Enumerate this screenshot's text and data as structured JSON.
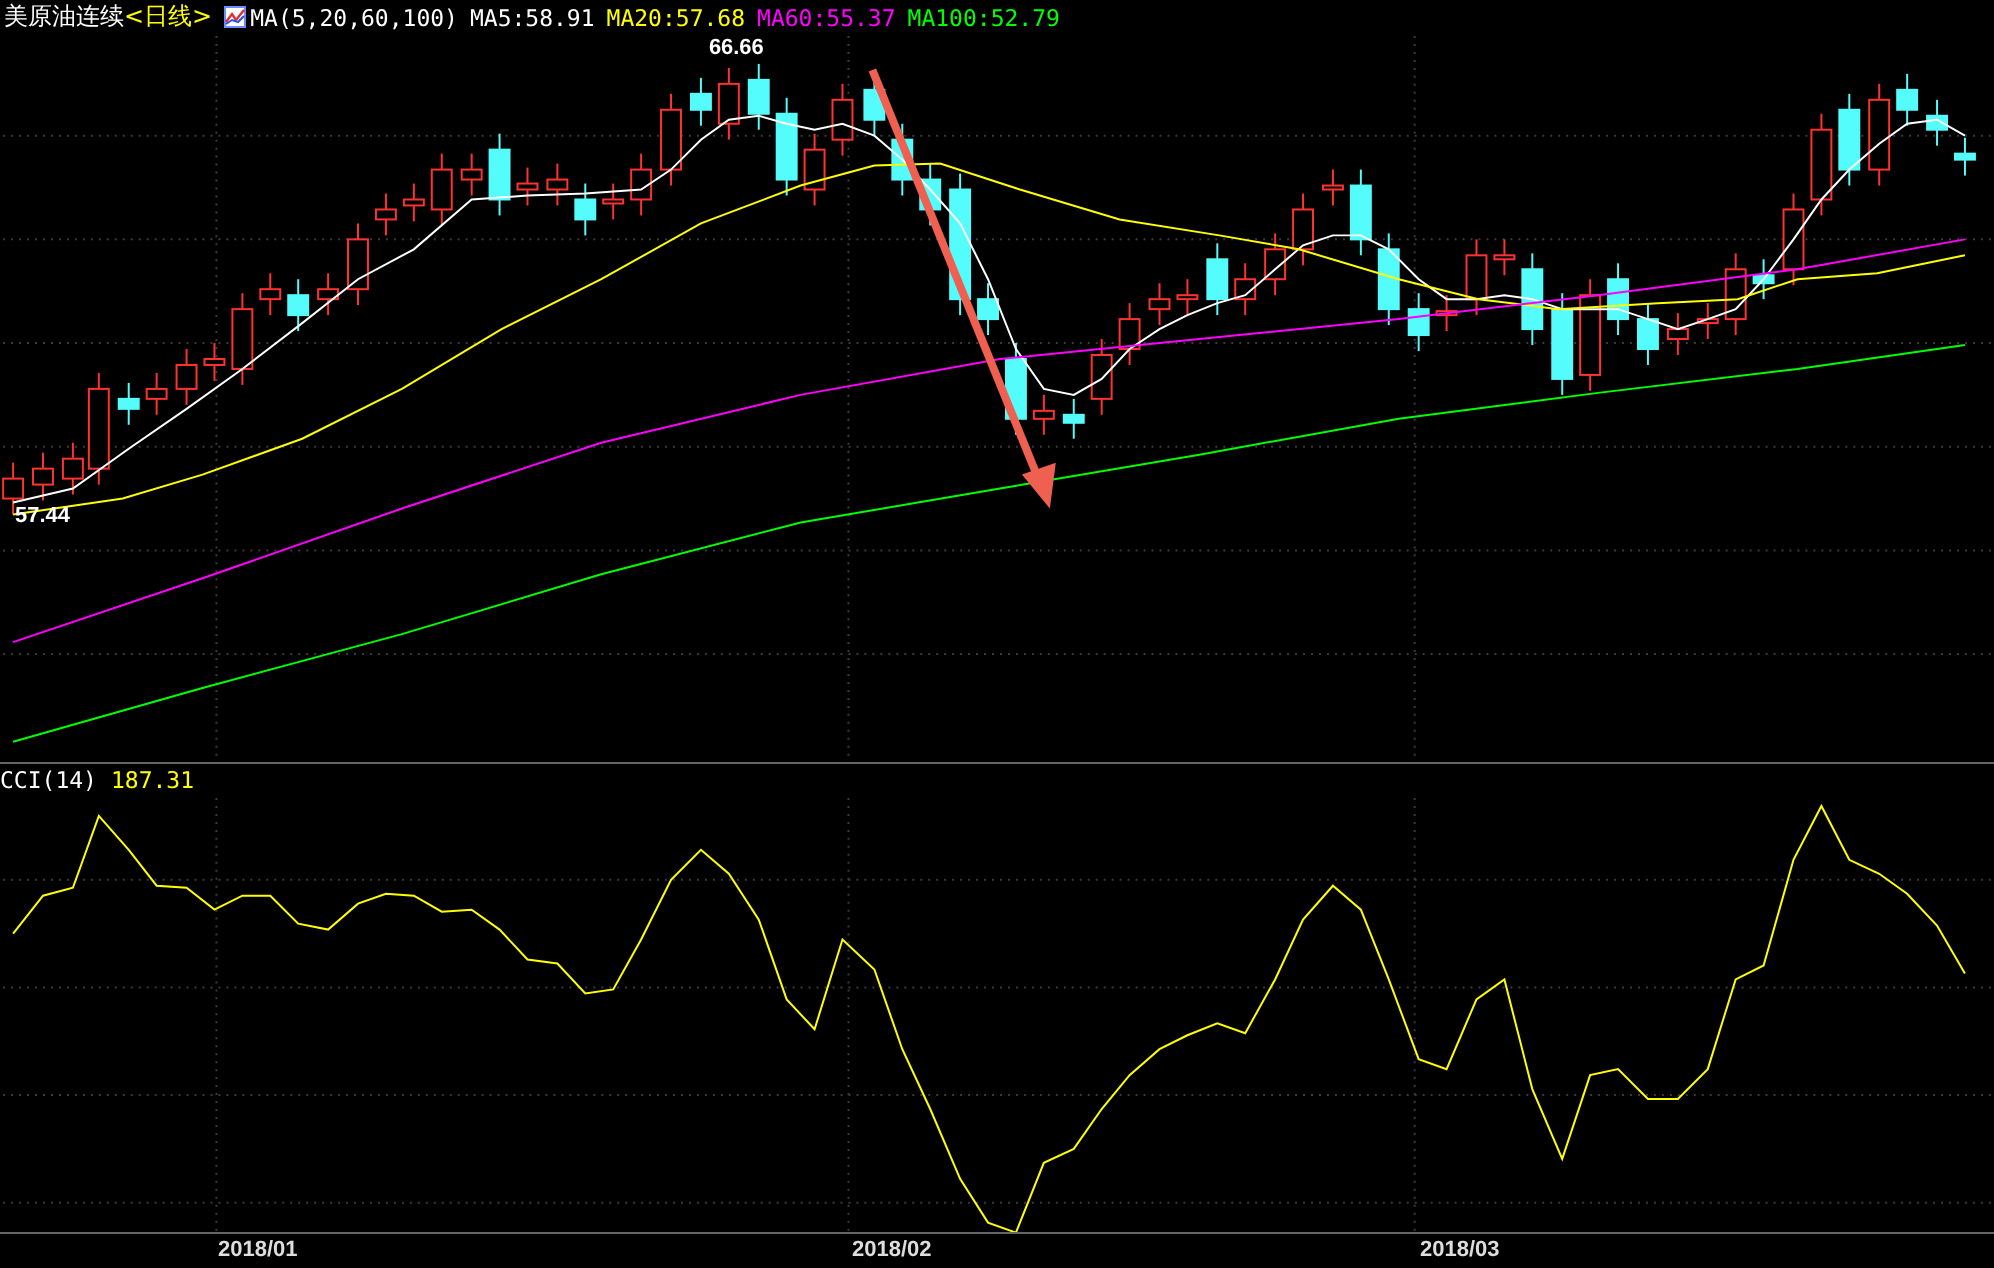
{
  "header": {
    "title": "美原油连续",
    "period": "<日线>",
    "indicator": "MA(5,20,60,100)",
    "averages": [
      {
        "label": "MA5:58.91",
        "color": "#ffffff"
      },
      {
        "label": "MA20:57.68",
        "color": "#ffff00"
      },
      {
        "label": "MA60:55.37",
        "color": "#ff00ff"
      },
      {
        "label": "MA100:52.79",
        "color": "#00ff00"
      }
    ]
  },
  "price_labels": {
    "high": "66.66",
    "low": "57.44"
  },
  "cci_panel": {
    "label": "CCI(14)",
    "value": "187.31"
  },
  "x_axis": [
    "2018/01",
    "2018/02",
    "2018/03"
  ]
}
